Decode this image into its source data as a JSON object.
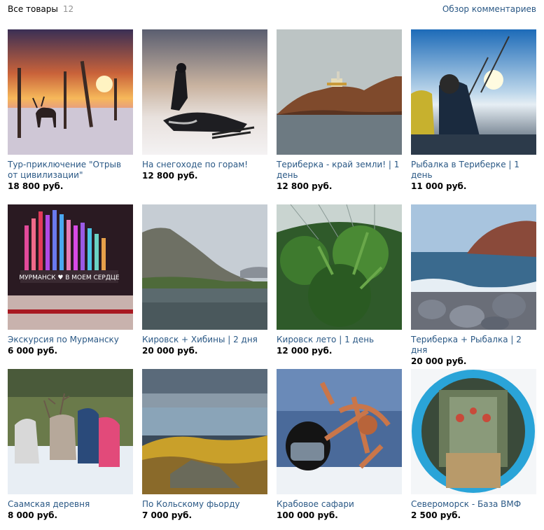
{
  "header": {
    "title": "Все товары",
    "count": "12",
    "review_link": "Обзор комментариев"
  },
  "colors": {
    "link": "#2a5885",
    "muted": "#939393",
    "text": "#000000"
  },
  "items": [
    {
      "name": "Тур-приключение \"Отрыв от цивилизации\"",
      "price": "18 800 руб.",
      "icon": "reindeer-sunset-photo"
    },
    {
      "name": "На снегоходе по горам!",
      "price": "12 800 руб.",
      "icon": "snowmobile-photo"
    },
    {
      "name": "Териберка - край земли! | 1 день",
      "price": "12 800 руб.",
      "icon": "lighthouse-island-photo"
    },
    {
      "name": "Рыбалка в Териберке | 1 день",
      "price": "11 000 руб.",
      "icon": "fishing-photo"
    },
    {
      "name": "Экскурсия по Мурманску",
      "price": "6 000 руб.",
      "icon": "murmansk-sign-photo"
    },
    {
      "name": "Кировск + Хибины | 2 дня",
      "price": "20 000 руб.",
      "icon": "khibiny-mountain-photo"
    },
    {
      "name": "Кировск лето | 1 день",
      "price": "12 000 руб.",
      "icon": "greenhouse-plants-photo"
    },
    {
      "name": "Териберка + Рыбалка | 2 дня",
      "price": "20 000 руб.",
      "icon": "rocky-shore-photo"
    },
    {
      "name": "Саамская деревня",
      "price": "8 000 руб.",
      "icon": "saami-reindeer-photo"
    },
    {
      "name": "По Кольскому фьорду",
      "price": "7 000 руб.",
      "icon": "kola-fjord-photo"
    },
    {
      "name": "Крабовое сафари",
      "price": "100 000 руб.",
      "icon": "crab-diver-photo"
    },
    {
      "name": "Североморск - База ВМФ",
      "price": "2 500 руб.",
      "icon": "submarine-interior-photo"
    }
  ]
}
